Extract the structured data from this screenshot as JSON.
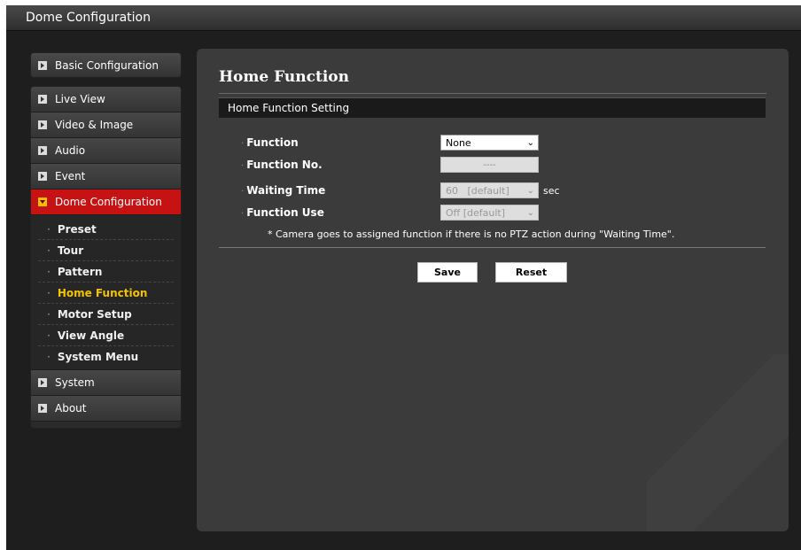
{
  "window": {
    "title": "Dome Configuration"
  },
  "sidebar": {
    "basic_config": "Basic Configuration",
    "items": [
      {
        "label": "Live View"
      },
      {
        "label": "Video & Image"
      },
      {
        "label": "Audio"
      },
      {
        "label": "Event"
      },
      {
        "label": "Dome Configuration",
        "active": true
      }
    ],
    "submenu": [
      {
        "label": "Preset"
      },
      {
        "label": "Tour"
      },
      {
        "label": "Pattern"
      },
      {
        "label": "Home Function",
        "current": true
      },
      {
        "label": "Motor Setup"
      },
      {
        "label": "View Angle"
      },
      {
        "label": "System Menu"
      }
    ],
    "bottom_items": [
      {
        "label": "System"
      },
      {
        "label": "About"
      }
    ]
  },
  "main": {
    "page_title": "Home Function",
    "section_title": "Home Function Setting",
    "fields": {
      "function": {
        "label": "Function",
        "value": "None"
      },
      "function_no": {
        "label": "Function No.",
        "value": "----"
      },
      "waiting_time": {
        "label": "Waiting Time",
        "value": "60   [default]",
        "unit": "sec"
      },
      "function_use": {
        "label": "Function Use",
        "value": "Off [default]"
      }
    },
    "note": "* Camera goes to assigned function if there is no PTZ action during \"Waiting Time\".",
    "save_label": "Save",
    "reset_label": "Reset"
  },
  "colors": {
    "active_menu": "#c61212",
    "current_submenu": "#f2c200",
    "panel_bg": "#3b3b3b",
    "app_bg": "#1e1e1e"
  }
}
